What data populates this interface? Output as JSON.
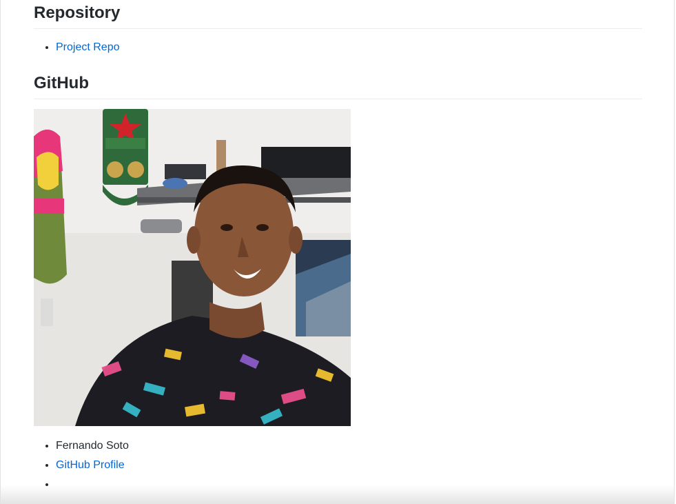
{
  "sections": {
    "repository": {
      "heading": "Repository",
      "links": [
        {
          "label": "Project Repo"
        }
      ]
    },
    "github": {
      "heading": "GitHub",
      "photo_icon": "profile-photo",
      "items": {
        "name": "Fernando Soto",
        "profile_link": "GitHub Profile",
        "empty": ""
      }
    }
  },
  "colors": {
    "link": "#0366d6",
    "text": "#24292e",
    "rule": "#eaecef"
  }
}
